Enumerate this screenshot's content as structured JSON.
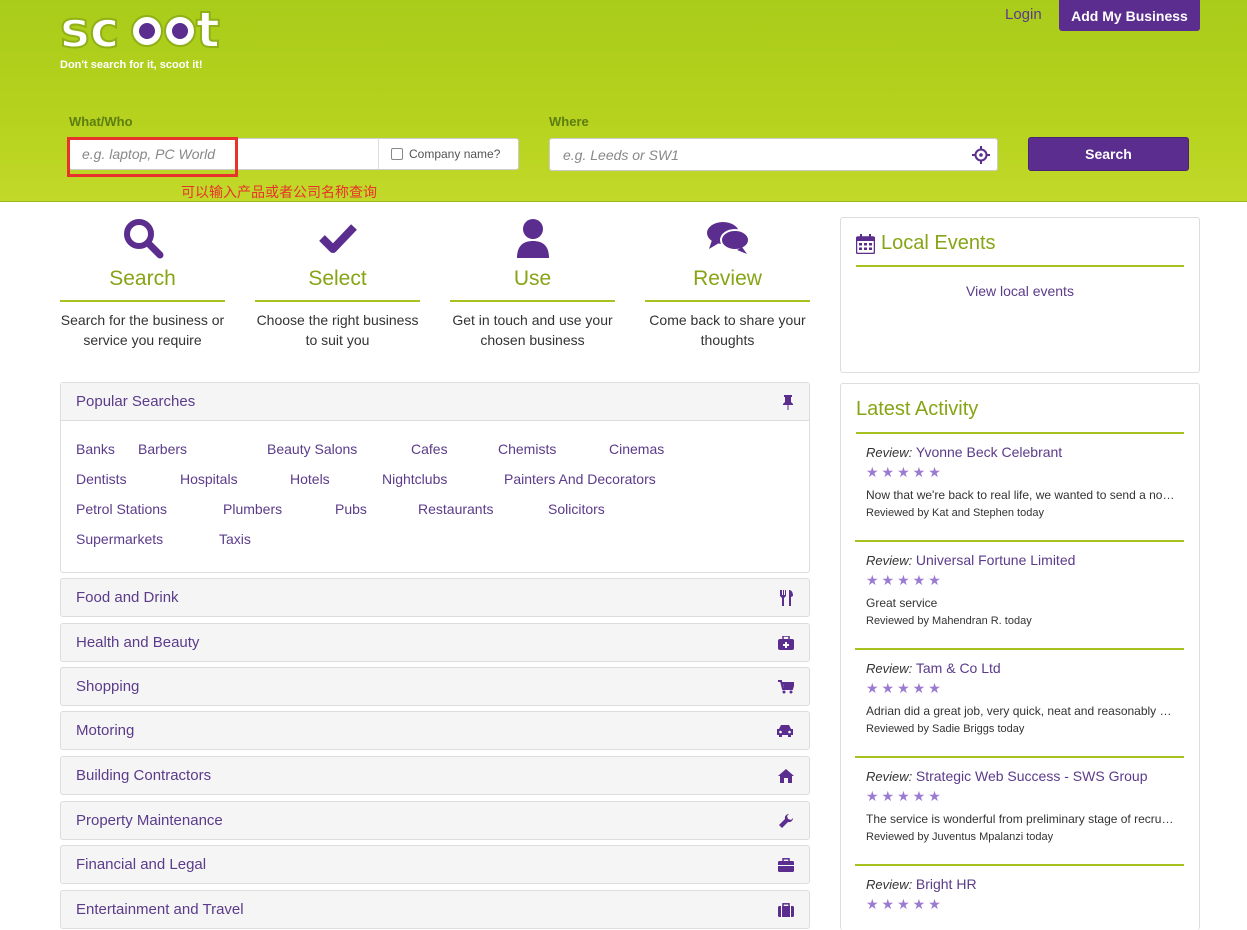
{
  "header": {
    "tagline": "Don't search for it, scoot it!",
    "login": "Login",
    "add_business": "Add My Business",
    "what_label": "What/Who",
    "what_placeholder": "e.g. laptop, PC World",
    "company_label": "Company name?",
    "annotation": "可以输入产品或者公司名称查询",
    "where_label": "Where",
    "where_placeholder": "e.g. Leeds or SW1",
    "search_button": "Search"
  },
  "steps": [
    {
      "title": "Search",
      "desc": "Search for the business or service you require",
      "icon": "magnifier-icon"
    },
    {
      "title": "Select",
      "desc": "Choose the right business to suit you",
      "icon": "check-icon"
    },
    {
      "title": "Use",
      "desc": "Get in touch and use your chosen business",
      "icon": "user-icon"
    },
    {
      "title": "Review",
      "desc": "Come back to share your thoughts",
      "icon": "comments-icon"
    }
  ],
  "popular": {
    "title": "Popular Searches",
    "links": [
      "Banks",
      "Barbers",
      "Beauty Salons",
      "Cafes",
      "Chemists",
      "Cinemas",
      "Dentists",
      "Hospitals",
      "Hotels",
      "Nightclubs",
      "Painters And Decorators",
      "Petrol Stations",
      "Plumbers",
      "Pubs",
      "Restaurants",
      "Solicitors",
      "Supermarkets",
      "Taxis"
    ]
  },
  "categories": [
    {
      "label": "Food and Drink",
      "icon": "cutlery-icon"
    },
    {
      "label": "Health and Beauty",
      "icon": "medkit-icon"
    },
    {
      "label": "Shopping",
      "icon": "cart-icon"
    },
    {
      "label": "Motoring",
      "icon": "car-icon"
    },
    {
      "label": "Building Contractors",
      "icon": "home-icon"
    },
    {
      "label": "Property Maintenance",
      "icon": "wrench-icon"
    },
    {
      "label": "Financial and Legal",
      "icon": "briefcase-icon"
    },
    {
      "label": "Entertainment and Travel",
      "icon": "suitcase-icon"
    }
  ],
  "events": {
    "title": "Local Events",
    "link": "View local events"
  },
  "activity": {
    "title": "Latest Activity",
    "prefix": "Review:",
    "stars": "★★★★★",
    "items": [
      {
        "name": "Yvonne Beck Celebrant",
        "text": "Now that we're back to real life, we wanted to send a note of thanks",
        "by": "Reviewed by Kat and Stephen today"
      },
      {
        "name": "Universal Fortune Limited",
        "text": "Great service",
        "by": "Reviewed by Mahendran R. today"
      },
      {
        "name": "Tam & Co Ltd",
        "text": "Adrian did a great job, very quick, neat and reasonably priced",
        "by": "Reviewed by Sadie Briggs today"
      },
      {
        "name": "Strategic Web Success - SWS Group",
        "text": "The service is wonderful from preliminary stage of recruitment",
        "by": "Reviewed by Juventus Mpalanzi today"
      },
      {
        "name": "Bright HR",
        "text": "",
        "by": ""
      }
    ]
  },
  "colors": {
    "brand_green": "#a9cc1a",
    "brand_purple": "#5b2d8e",
    "accent_green_text": "#86a516",
    "annotation_red": "#e8322c"
  }
}
